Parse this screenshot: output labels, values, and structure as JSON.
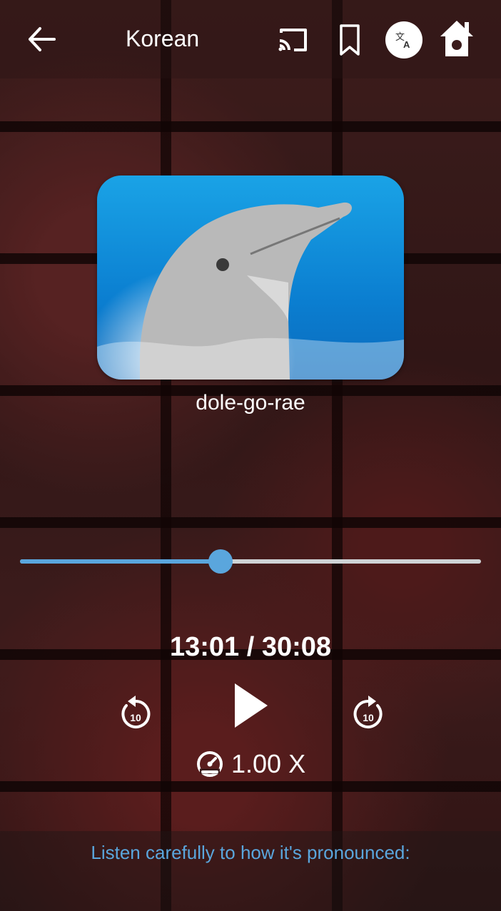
{
  "app_bar": {
    "title": "Korean",
    "back_icon": "arrow-left-icon",
    "cast_icon": "cast-icon",
    "bookmark_icon": "bookmark-icon",
    "translate_icon": "translate-icon",
    "home_icon": "home-icon"
  },
  "card": {
    "image": "dolphin-photo",
    "word": "dole-go-rae"
  },
  "player": {
    "progress": 0.435,
    "time_label": "13:01 / 30:08",
    "rewind_label": "10",
    "forward_label": "10",
    "speed_label": "1.00 X",
    "accent_color": "#5aa6dd"
  },
  "footer": {
    "hint": "Listen carefully to how it's pronounced:"
  }
}
